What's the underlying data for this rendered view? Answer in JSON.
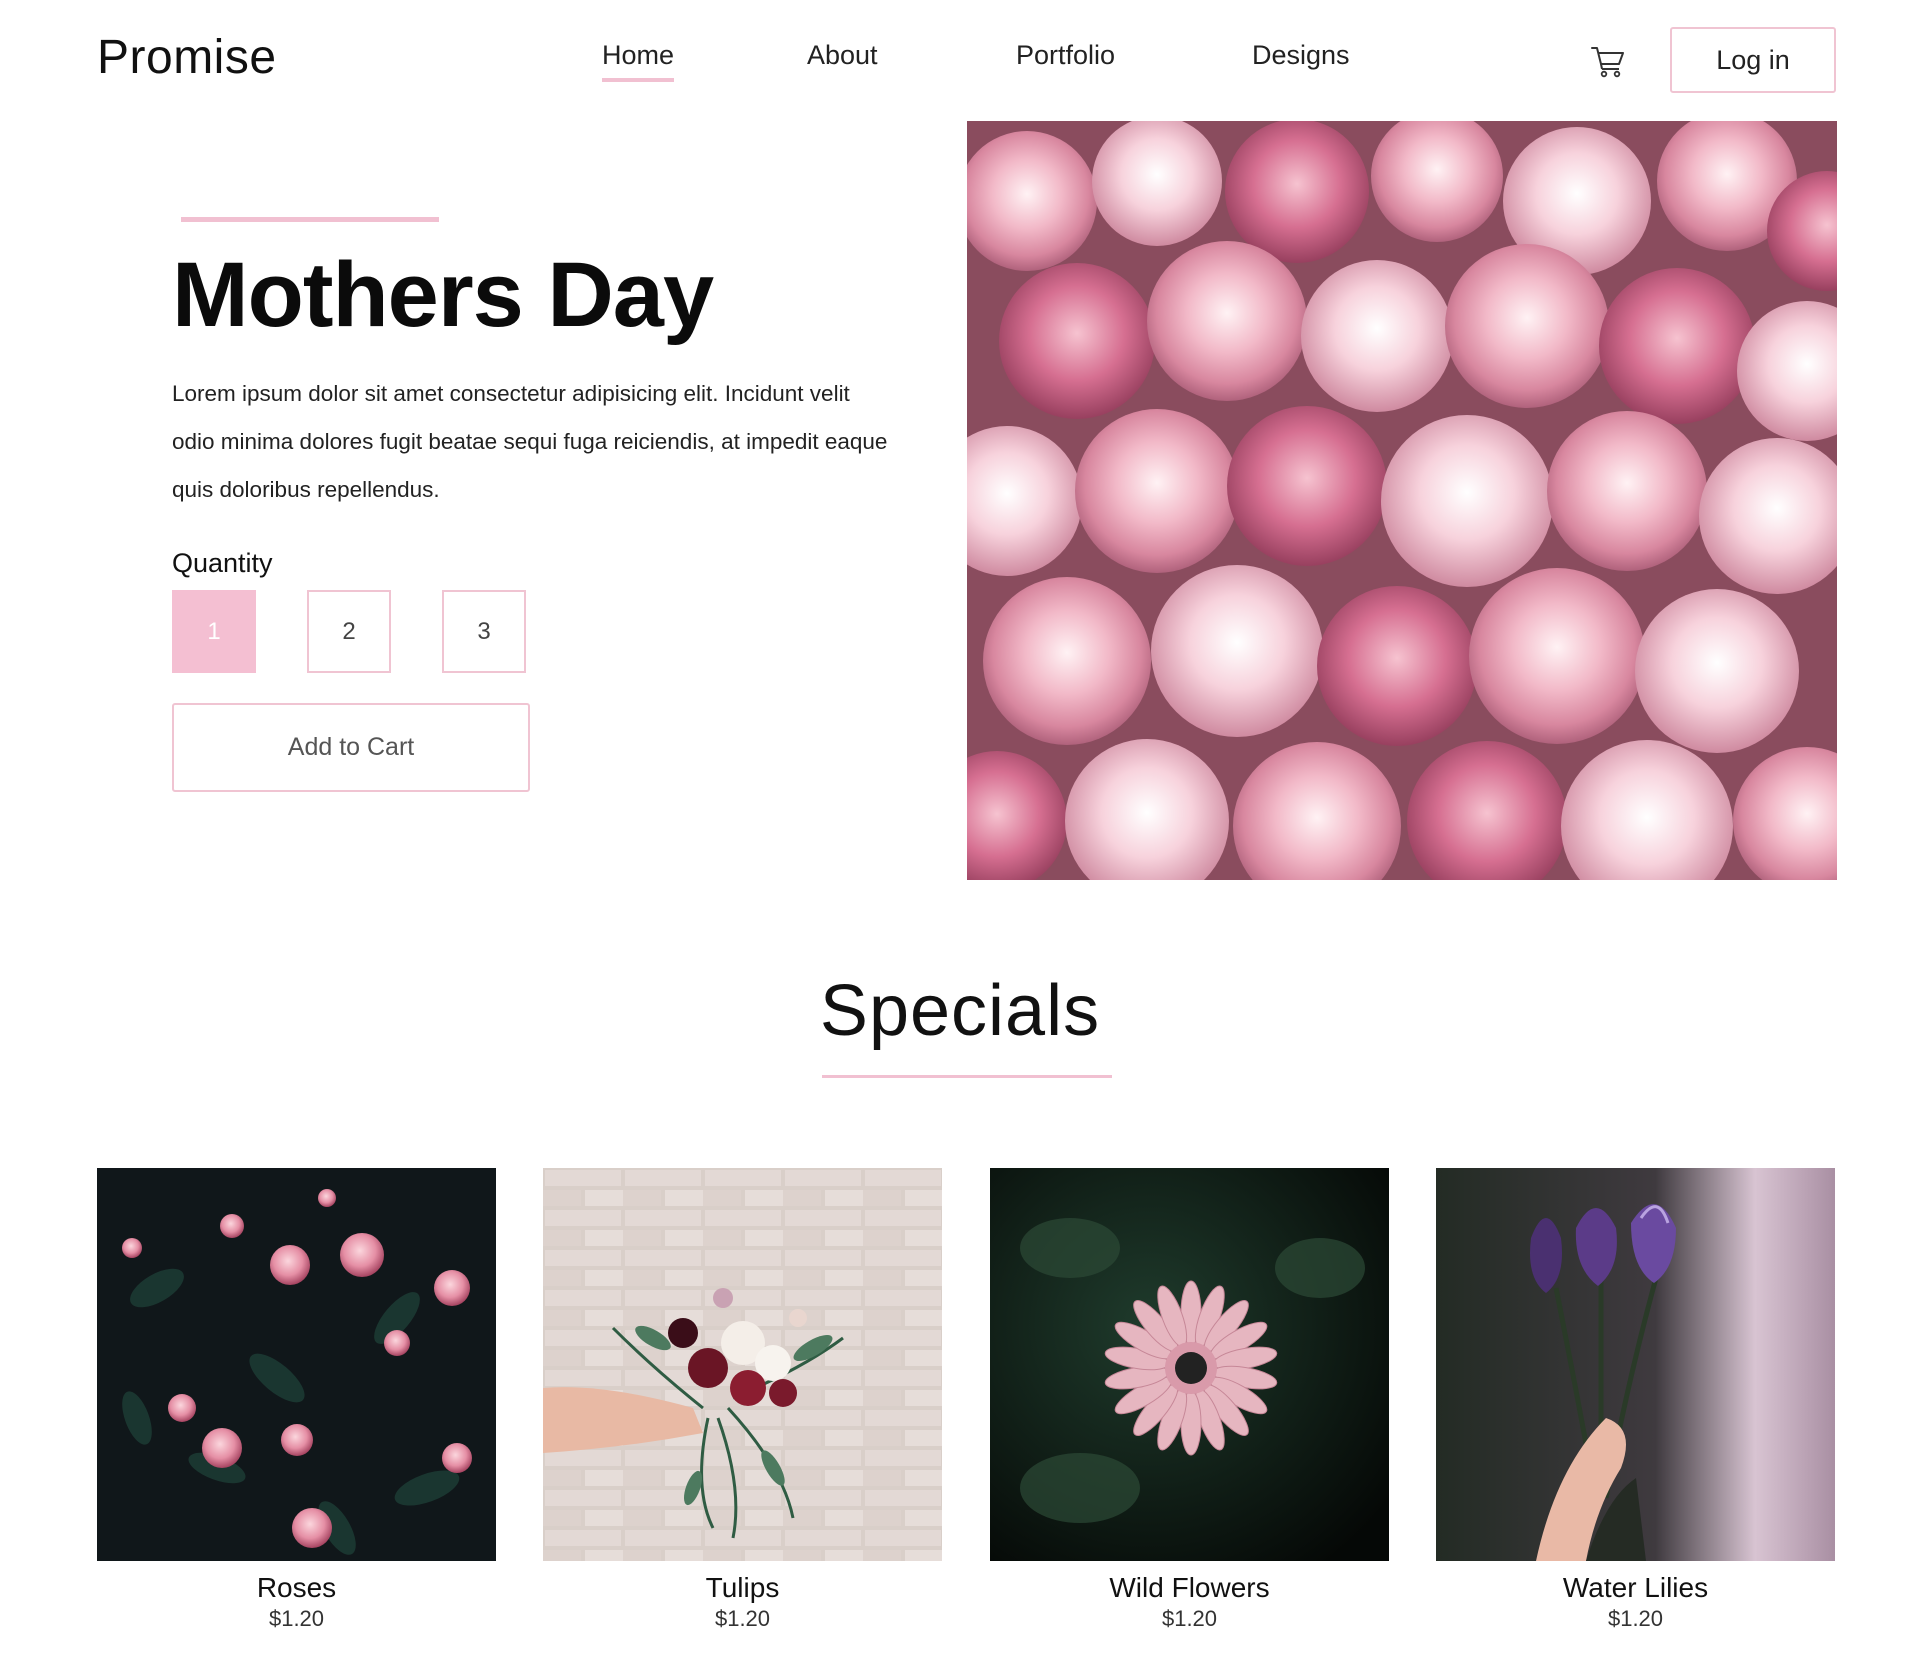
{
  "header": {
    "logo": "Promise",
    "nav": [
      {
        "label": "Home",
        "active": true
      },
      {
        "label": "About",
        "active": false
      },
      {
        "label": "Portfolio",
        "active": false
      },
      {
        "label": "Designs",
        "active": false
      }
    ],
    "cart_icon": "shopping-cart-icon",
    "login_label": "Log in"
  },
  "hero": {
    "title": "Mothers Day",
    "description": "Lorem ipsum dolor sit amet consectetur adipisicing elit. Incidunt velit\nodio minima dolores fugit beatae sequi fuga reiciendis, at impedit eaque\nquis doloribus repellendus.",
    "quantity_label": "Quantity",
    "quantity_options": [
      "1",
      "2",
      "3"
    ],
    "selected_quantity": "1",
    "add_to_cart_label": "Add to Cart"
  },
  "specials": {
    "title": "Specials",
    "products": [
      {
        "name": "Roses",
        "price": "$1.20"
      },
      {
        "name": "Tulips",
        "price": "$1.20"
      },
      {
        "name": "Wild Flowers",
        "price": "$1.20"
      },
      {
        "name": "Water Lilies",
        "price": "$1.20"
      }
    ]
  },
  "colors": {
    "accent": "#f1c0d1",
    "accent_border": "#f0c4d2",
    "selected_qty_bg": "#f4bfd2",
    "text": "#111111"
  }
}
